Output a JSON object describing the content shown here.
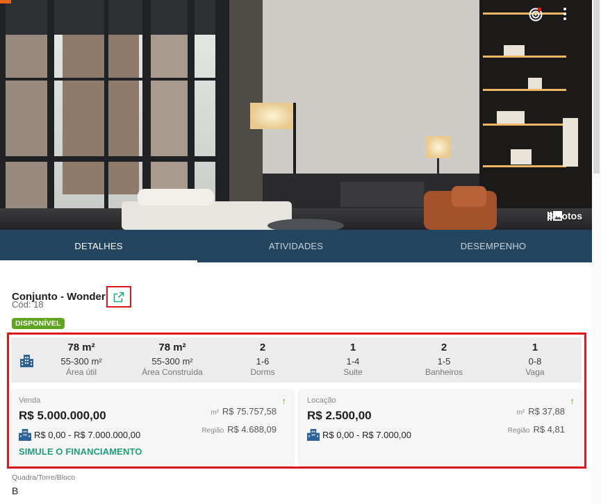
{
  "hero": {
    "photo_count_label": "8 Fotos",
    "photo_icon": "photo-library-icon",
    "actions": [
      "target-icon",
      "more-vertical-icon"
    ]
  },
  "tabs": [
    {
      "label": "DETALHES",
      "active": true
    },
    {
      "label": "ATIVIDADES",
      "active": false
    },
    {
      "label": "DESEMPENHO",
      "active": false
    }
  ],
  "property": {
    "title": "Conjunto - Wonder",
    "code": "Cód: 18",
    "status": "DISPONÍVEL",
    "external_link_icon": "open-in-new-icon"
  },
  "stats": {
    "icon": "building-icon",
    "items": [
      {
        "value": "78 m²",
        "range": "55-300 m²",
        "label": "Área útil"
      },
      {
        "value": "78 m²",
        "range": "55-300 m²",
        "label": "Área Construída"
      },
      {
        "value": "2",
        "range": "1-6",
        "label": "Dorms"
      },
      {
        "value": "1",
        "range": "1-4",
        "label": "Suite"
      },
      {
        "value": "2",
        "range": "1-5",
        "label": "Banheiros"
      },
      {
        "value": "1",
        "range": "0-8",
        "label": "Vaga"
      }
    ]
  },
  "sale": {
    "label": "Venda",
    "value": "R$ 5.000.000,00",
    "range": "R$ 0,00 - R$ 7.000.000,00",
    "m2_unit": "m²",
    "m2_value": "R$ 75.757,58",
    "region_unit": "Região",
    "region_value": "R$ 4.688,09",
    "trend": "↑",
    "simulate_label": "SIMULE O FINANCIAMENTO"
  },
  "rent": {
    "label": "Locação",
    "value": "R$ 2.500,00",
    "range": "R$ 0,00 - R$ 7.000,00",
    "m2_unit": "m²",
    "m2_value": "R$ 37,88",
    "region_unit": "Região",
    "region_value": "R$ 4,81",
    "trend": "↑"
  },
  "extra": {
    "field_label": "Quadra/Torre/Bloco",
    "field_value": "B"
  },
  "colors": {
    "tabs_bg": "#23455f",
    "status_green": "#5ea620",
    "link_teal": "#1fa079",
    "highlight_red": "#e0161c"
  }
}
